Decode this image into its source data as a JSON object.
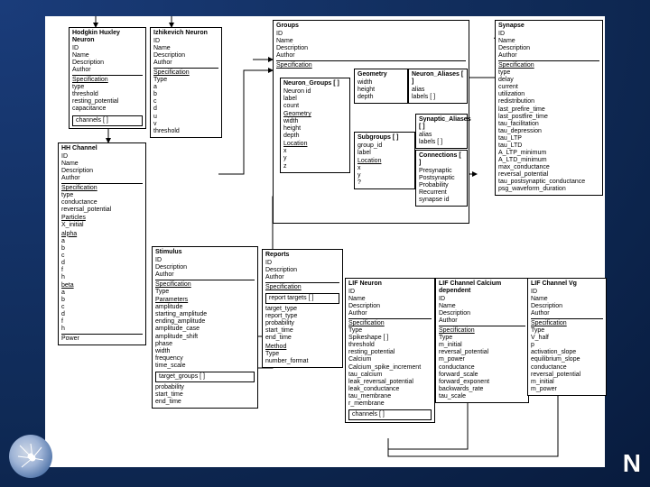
{
  "boxes": {
    "hh_neuron": {
      "title": "Hodgkin Huxley Neuron",
      "header": [
        "ID",
        "Name",
        "Description",
        "Author"
      ],
      "spec_label": "Specification",
      "spec": [
        "type",
        "threshold",
        "resting_potential",
        "capacitance"
      ],
      "array": "channels [ ]"
    },
    "izh_neuron": {
      "title": "Izhikevich Neuron",
      "header": [
        "ID",
        "Name",
        "Description",
        "Author"
      ],
      "spec_label": "Specification",
      "spec": [
        "Type",
        "a",
        "b",
        "c",
        "d",
        "u",
        "v",
        "threshold"
      ]
    },
    "hh_channel": {
      "title": "HH Channel",
      "header": [
        "ID",
        "Name",
        "Description",
        "Author"
      ],
      "spec_label": "Specification",
      "spec": [
        "type",
        "conductance",
        "reversal_potential"
      ],
      "particles_label": "Particles",
      "particles_head": "X_initial",
      "alpha_label": "alpha",
      "alpha": [
        "a",
        "b",
        "c",
        "d",
        "f",
        "h"
      ],
      "beta_label": "beta",
      "beta": [
        "a",
        "b",
        "c",
        "d",
        "f",
        "h"
      ],
      "power_label": "Power"
    },
    "stimulus": {
      "title": "Stimulus",
      "header": [
        "ID",
        "Description",
        "Author"
      ],
      "spec_label": "Specification",
      "spec_head": "Type",
      "params_label": "Parameters",
      "params": [
        "amplitude",
        "starting_amplitude",
        "ending_amplitude",
        "amplitude_case",
        "amplitude_shift",
        "phase",
        "width",
        "frequency",
        "time_scale"
      ],
      "targets": "target_groups [ ]",
      "tail": [
        "probability",
        "start_time",
        "end_time"
      ]
    },
    "groups_outer": {
      "title": "Groups",
      "header": [
        "ID",
        "Name",
        "Description",
        "Author"
      ],
      "spec_label": "Specification"
    },
    "neuron_groups": {
      "title": "Neuron_Groups [ ]",
      "fields": [
        "Neuron id",
        "label",
        "count"
      ],
      "geom_label": "Geometry",
      "geom": [
        "width",
        "height",
        "depth"
      ],
      "loc_label": "Location",
      "loc": [
        "x",
        "y",
        "z"
      ]
    },
    "geometry": {
      "title": "Geometry",
      "fields": [
        "width",
        "height",
        "depth"
      ]
    },
    "neuron_aliases": {
      "title": "Neuron_Aliases [ ]",
      "fields": [
        "alias",
        "labels [ ]"
      ]
    },
    "subgroups": {
      "title": "Subgroups [ ]",
      "fields": [
        "group_id",
        "label"
      ],
      "loc_label": "Location",
      "loc": [
        "x",
        "y",
        "?"
      ]
    },
    "syn_aliases": {
      "title": "Synaptic_Aliases [ ]",
      "fields": [
        "alias",
        "labels [ ]"
      ]
    },
    "connections": {
      "title": "Connections [ ]",
      "fields": [
        "Presynaptic",
        "Postsynaptic",
        "Probability",
        "Recurrent",
        "synapse id"
      ]
    },
    "synapse": {
      "title": "Synapse",
      "header": [
        "ID",
        "Name",
        "Description",
        "Author"
      ],
      "spec_label": "Specification",
      "spec": [
        "type",
        "delay",
        "current",
        "utilization",
        "redistribution",
        "last_prefire_time",
        "last_postfire_time",
        "tau_facilitation",
        "tau_depression",
        "tau_LTP",
        "tau_LTD",
        "A_LTP_minimum",
        "A_LTD_minimum",
        "max_conductance",
        "reversal_potential",
        "tau_postsynaptic_conductance",
        "psg_waveform_duration"
      ]
    },
    "reports": {
      "title": "Reports",
      "header": [
        "ID",
        "Description",
        "Author"
      ],
      "spec_label": "Specification",
      "targets": "report targets [ ]",
      "spec": [
        "target_type",
        "report_type",
        "probability",
        "start_time",
        "end_time"
      ],
      "method_label": "Method",
      "method": [
        "Type",
        "number_format"
      ]
    },
    "lif_neuron": {
      "title": "LIF Neuron",
      "header": [
        "ID",
        "Name",
        "Description",
        "Author"
      ],
      "spec_label": "Specification",
      "spec": [
        "Type",
        "Spikeshape [ ]",
        "threshold",
        "resting_potential",
        "Calcium",
        "Calcium_spike_increment",
        "tau_calcium",
        "leak_reversal_potential",
        "leak_conductance",
        "tau_membrane",
        "r_membrane"
      ],
      "array": "channels [ ]"
    },
    "lif_ch_ca": {
      "title": "LIF Channel Calcium dependent",
      "header": [
        "ID",
        "Name",
        "Description",
        "Author"
      ],
      "spec_label": "Specification",
      "spec": [
        "Type",
        "m_initial",
        "reversal_potential",
        "m_power",
        "conductance",
        "forward_scale",
        "forward_exponent",
        "backwards_rate",
        "tau_scale"
      ]
    },
    "lif_ch_vg": {
      "title": "LIF Channel Vg",
      "header": [
        "ID",
        "Name",
        "Description",
        "Author"
      ],
      "spec_label": "Specification",
      "spec": [
        "Type",
        "V_half",
        "p",
        "activation_slope",
        "equilibrium_slope",
        "conductance",
        "reversal_potential",
        "m_initial",
        "m_power"
      ]
    }
  },
  "univ_text": "N"
}
